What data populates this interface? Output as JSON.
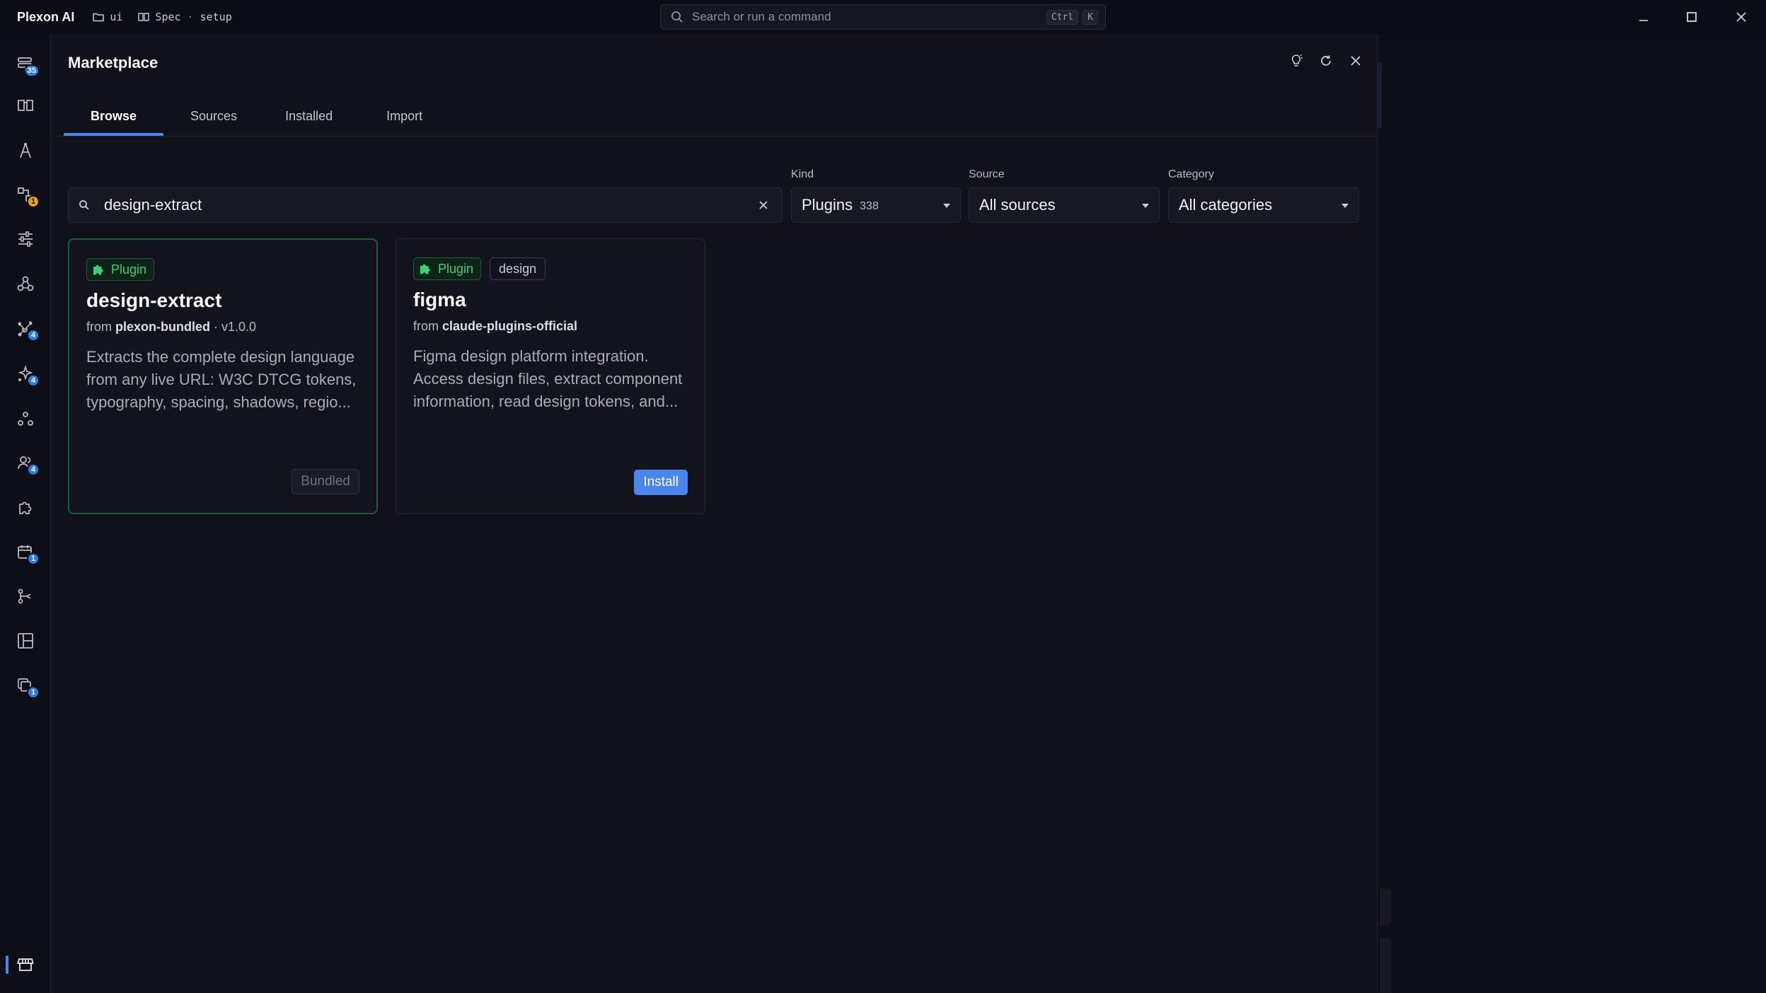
{
  "titlebar": {
    "app_name": "Plexon AI",
    "project": "ui",
    "spec": "Spec",
    "spec_sep": "·",
    "spec_name": "setup",
    "command_placeholder": "Search or run a command",
    "shortcut_ctrl": "Ctrl",
    "shortcut_key": "K"
  },
  "rail": {
    "items": [
      {
        "icon": "sessions-icon",
        "badge": "35"
      },
      {
        "icon": "book-icon",
        "badge": ""
      },
      {
        "icon": "compass-icon",
        "badge": ""
      },
      {
        "icon": "workflow-icon",
        "badge": "1"
      },
      {
        "icon": "sliders-icon",
        "badge": ""
      },
      {
        "icon": "webhook-icon",
        "badge": ""
      },
      {
        "icon": "graph-icon",
        "badge": "4"
      },
      {
        "icon": "agents-icon",
        "badge": "4"
      },
      {
        "icon": "nodes-icon",
        "badge": ""
      },
      {
        "icon": "team-icon",
        "badge": "4"
      },
      {
        "icon": "puzzle-icon",
        "badge": ""
      },
      {
        "icon": "calendar-icon",
        "badge": "1"
      },
      {
        "icon": "branch-icon",
        "badge": ""
      },
      {
        "icon": "layout-icon",
        "badge": ""
      },
      {
        "icon": "layers-icon",
        "badge": "1"
      },
      {
        "icon": "store-icon",
        "badge": ""
      }
    ]
  },
  "marketplace": {
    "title": "Marketplace",
    "tabs": [
      "Browse",
      "Sources",
      "Installed",
      "Import"
    ],
    "active_tab": "Browse",
    "search_value": "design-extract",
    "filters": {
      "kind_label": "Kind",
      "kind_value": "Plugins",
      "kind_count": "338",
      "source_label": "Source",
      "source_value": "All sources",
      "category_label": "Category",
      "category_value": "All categories"
    },
    "cards": [
      {
        "badge": "Plugin",
        "tag": "",
        "name": "design-extract",
        "from_prefix": "from",
        "source": "plexon-bundled",
        "version": "· v1.0.0",
        "description": "Extracts the complete design language from any live URL: W3C DTCG tokens, typography, spacing, shadows, regio...",
        "action": "Bundled"
      },
      {
        "badge": "Plugin",
        "tag": "design",
        "name": "figma",
        "from_prefix": "from",
        "source": "claude-plugins-official",
        "version": "",
        "description": "Figma design platform integration. Access design files, extract component information, read design tokens, and...",
        "action": "Install"
      }
    ]
  },
  "colors": {
    "accent": "#4a86f0",
    "plugin_green": "#3dd076",
    "badge_amber": "#e3a315",
    "background": "#101119"
  }
}
